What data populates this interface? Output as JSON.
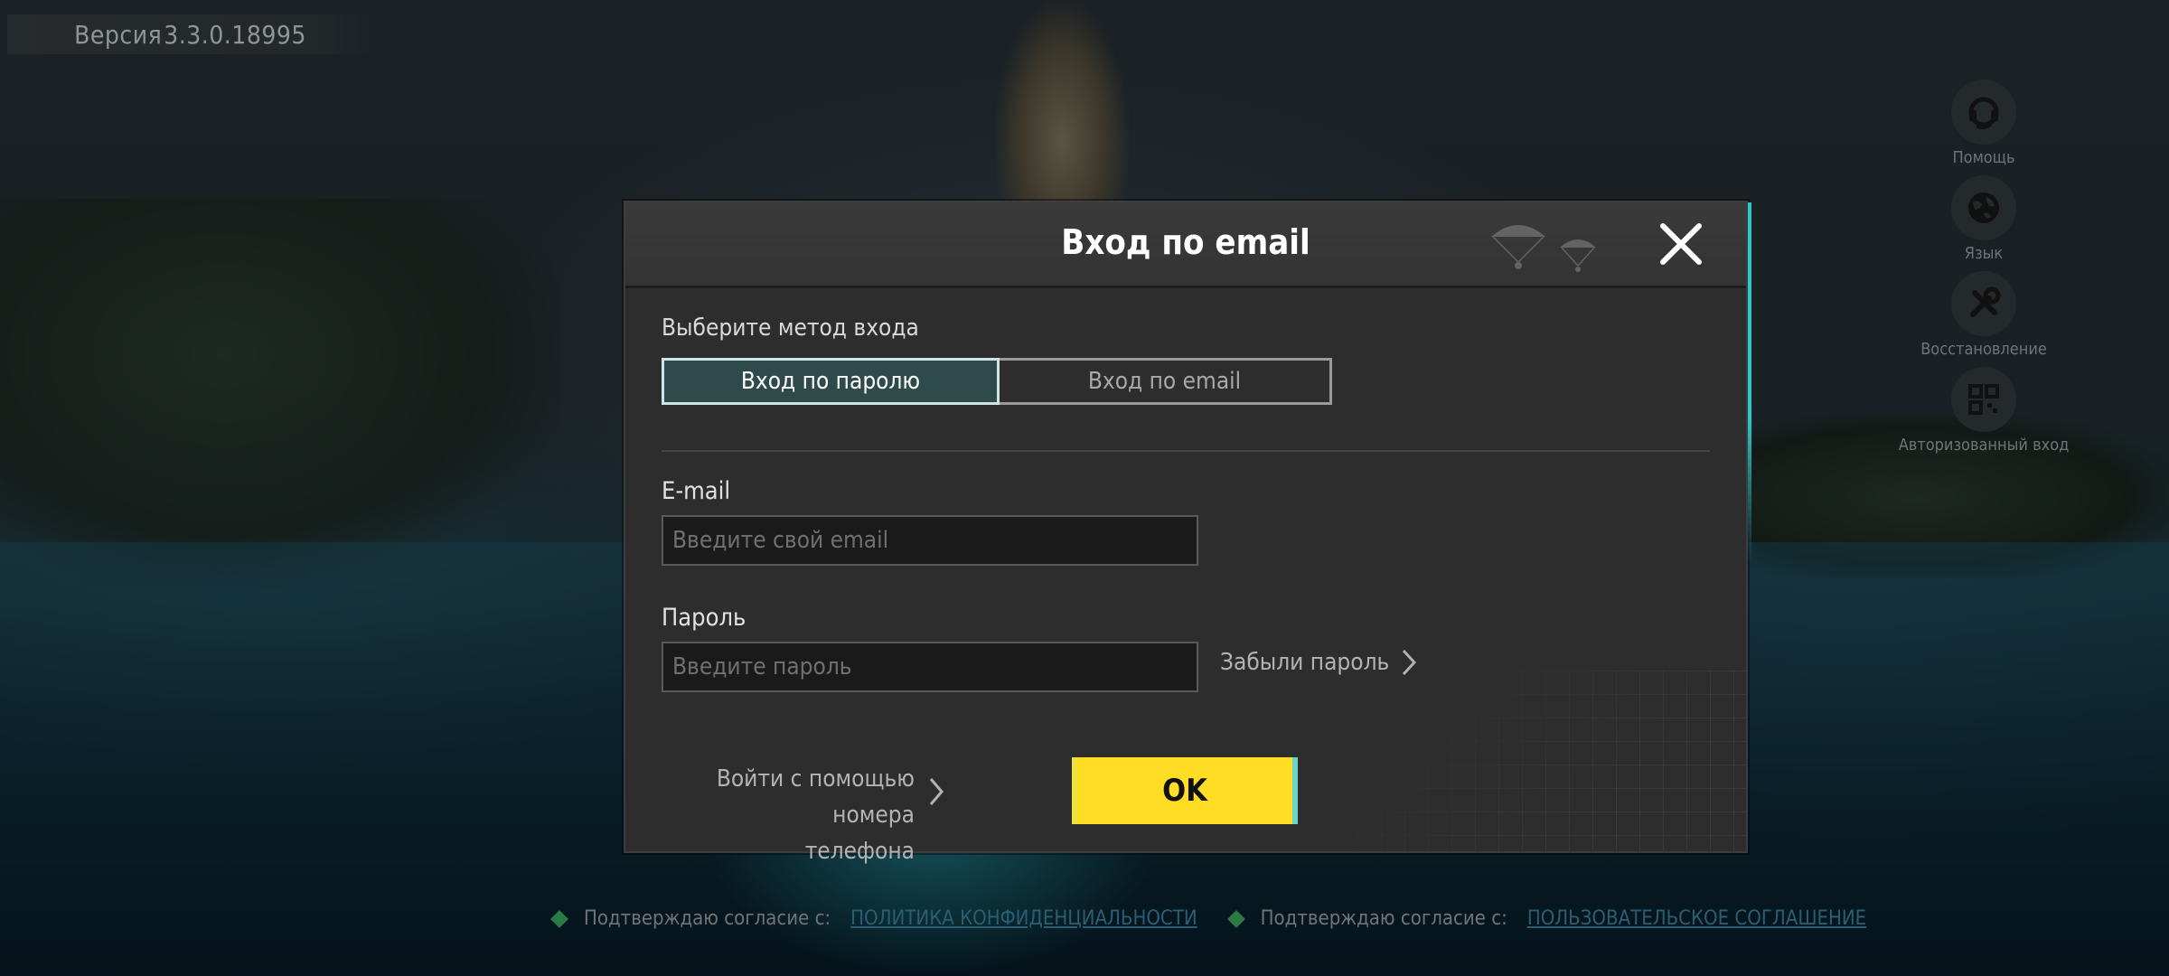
{
  "version": {
    "prefix": "Версия",
    "number": "3.3.0.18995"
  },
  "side_menu": [
    {
      "id": "help",
      "label": "Помощь",
      "icon": "headset-icon"
    },
    {
      "id": "language",
      "label": "Язык",
      "icon": "globe-icon"
    },
    {
      "id": "repair",
      "label": "Восстановление",
      "icon": "tools-icon"
    },
    {
      "id": "qr",
      "label": "Авторизованный вход",
      "icon": "qr-code-icon"
    }
  ],
  "dialog": {
    "title": "Вход по email",
    "method_label": "Выберите метод входа",
    "tabs": [
      {
        "label": "Вход по паролю",
        "active": true
      },
      {
        "label": "Вход по email",
        "active": false
      }
    ],
    "email": {
      "label": "E-mail",
      "value": "",
      "placeholder": "Введите свой email"
    },
    "password": {
      "label": "Пароль",
      "value": "",
      "placeholder": "Введите пароль"
    },
    "forgot_label": "Забыли пароль",
    "phone_login": {
      "line1": "Войти с помощью номера",
      "line2": "телефона"
    },
    "ok_label": "OK"
  },
  "footer": {
    "agree_text_1": "Подтверждаю согласие с:",
    "link_1": "ПОЛИТИКА КОНФИДЕНЦИАЛЬНОСТИ",
    "agree_text_2": "Подтверждаю согласие с:",
    "link_2": "ПОЛЬЗОВАТЕЛЬСКОЕ СОГЛАШЕНИЕ"
  },
  "colors": {
    "accent_yellow": "#ffdd24",
    "active_tab": "#2f4a4a",
    "dialog_bg": "#2d2d2d",
    "check_green": "#2a7a45",
    "link_blue": "#2a5e74"
  }
}
